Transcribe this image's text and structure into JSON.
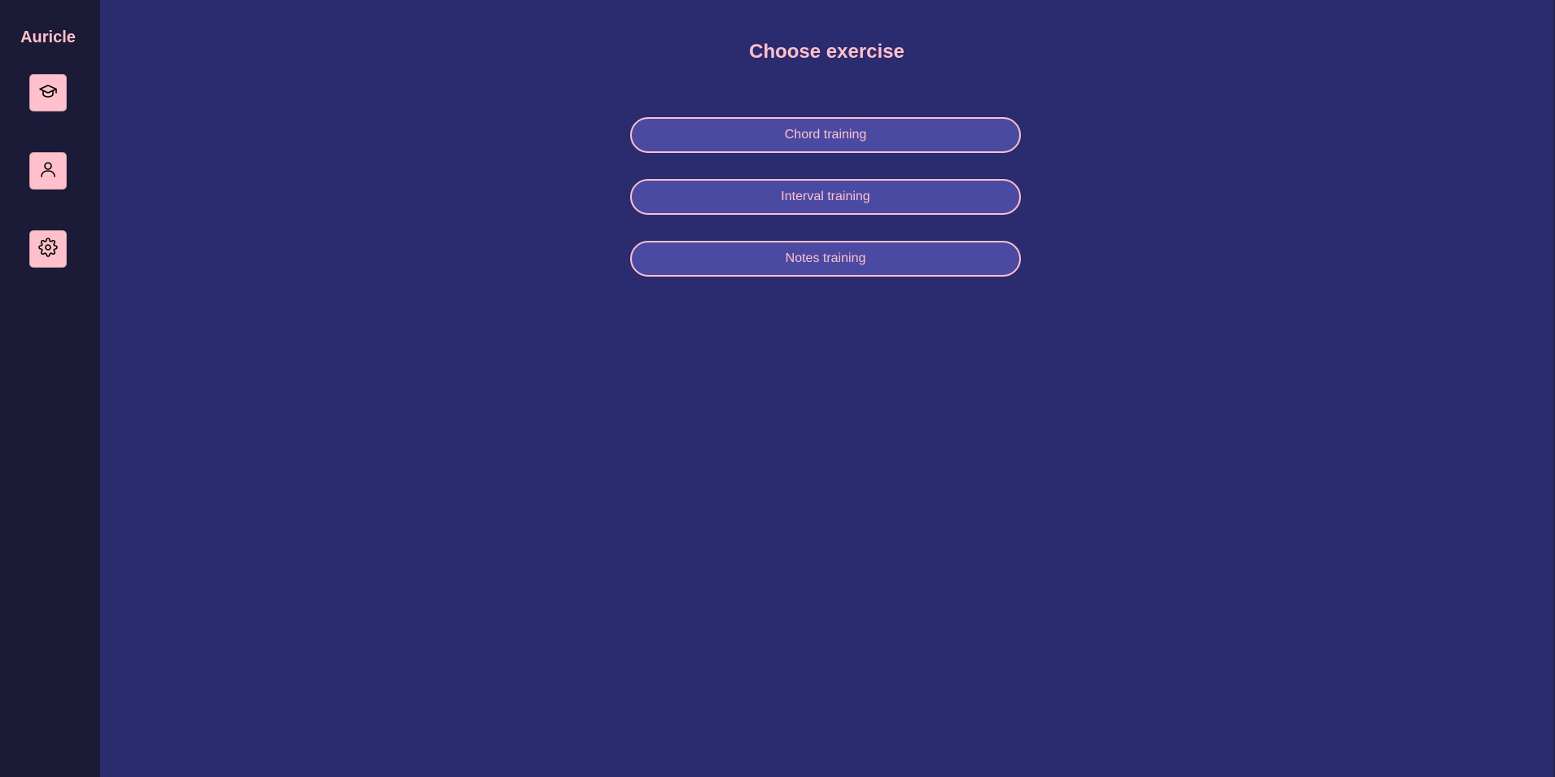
{
  "app": {
    "brand": "Auricle"
  },
  "sidebar": {
    "items": [
      {
        "icon": "graduation-cap-icon",
        "label": "Learn"
      },
      {
        "icon": "user-icon",
        "label": "Profile"
      },
      {
        "icon": "gear-icon",
        "label": "Settings"
      }
    ]
  },
  "main": {
    "title": "Choose exercise",
    "exercises": [
      {
        "label": "Chord training"
      },
      {
        "label": "Interval training"
      },
      {
        "label": "Notes training"
      }
    ]
  },
  "colors": {
    "sidebar_bg": "#1b1a37",
    "main_bg": "#2b2b6f",
    "accent_pink": "#ffc0cb",
    "button_bg": "#4a4aa3"
  }
}
